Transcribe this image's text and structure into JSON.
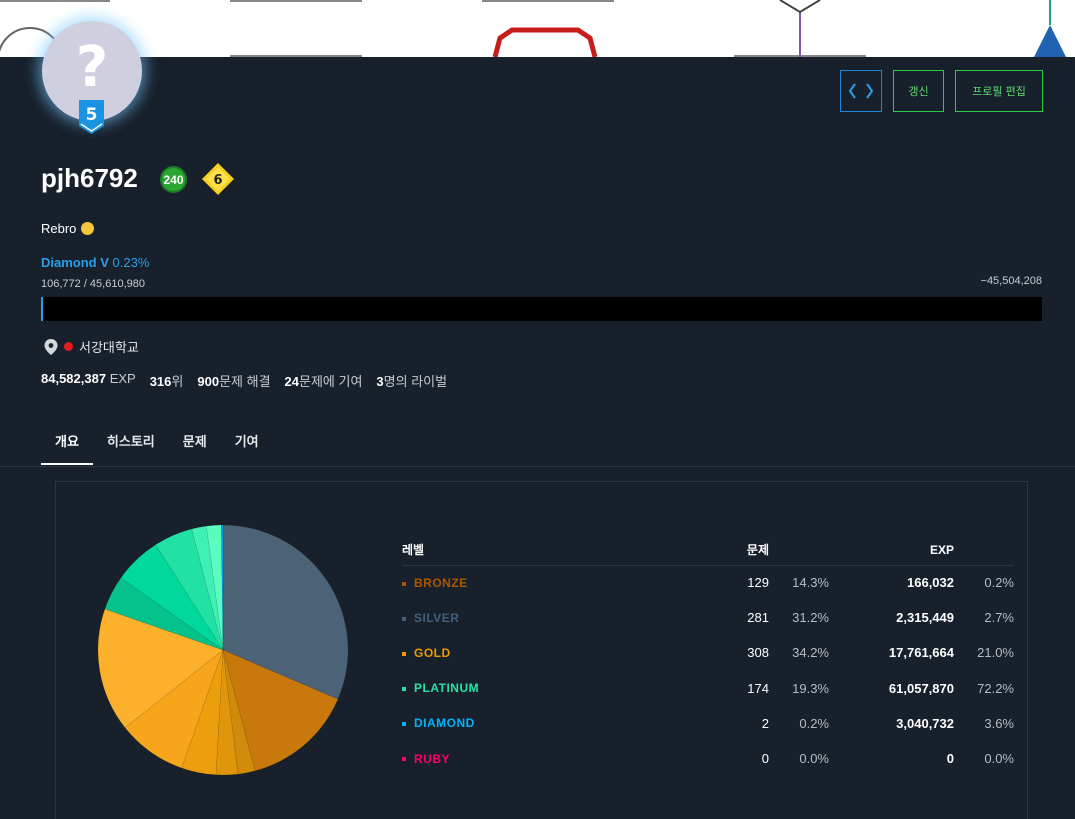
{
  "header": {
    "code_button_label": "/<>",
    "refresh_label": "갱신",
    "edit_label": "프로필 편집"
  },
  "profile": {
    "avatar_glyph": "?",
    "tier_number": "5",
    "username": "pjh6792",
    "level": "240",
    "class_number": "6",
    "bio": "Rebro",
    "rank_name": "Diamond V",
    "rank_pct": "0.23%",
    "progress_text": "106,772 / 45,610,980",
    "remaining_text": "−45,504,208",
    "progress_fraction": 0.0023,
    "school": "서강대학교"
  },
  "stats": [
    {
      "value": "84,582,387",
      "suffix": " EXP"
    },
    {
      "value": "316",
      "suffix": "위"
    },
    {
      "value": "900",
      "suffix": "문제 해결"
    },
    {
      "value": "24",
      "suffix": "문제에 기여"
    },
    {
      "value": "3",
      "suffix": "명의 라이벌"
    }
  ],
  "tabs": [
    {
      "label": "개요",
      "active": true
    },
    {
      "label": "히스토리",
      "active": false
    },
    {
      "label": "문제",
      "active": false
    },
    {
      "label": "기여",
      "active": false
    }
  ],
  "table": {
    "headers": {
      "level": "레벨",
      "problems": "문제",
      "exp": "EXP"
    },
    "rows": [
      {
        "level": "BRONZE",
        "color": "#ad5600",
        "count": "129",
        "count_pct": "14.3%",
        "exp": "166,032",
        "exp_pct": "0.2%"
      },
      {
        "level": "SILVER",
        "color": "#435f7a",
        "count": "281",
        "count_pct": "31.2%",
        "exp": "2,315,449",
        "exp_pct": "2.7%"
      },
      {
        "level": "GOLD",
        "color": "#ec9a00",
        "count": "308",
        "count_pct": "34.2%",
        "exp": "17,761,664",
        "exp_pct": "21.0%"
      },
      {
        "level": "PLATINUM",
        "color": "#27e2a4",
        "count": "174",
        "count_pct": "19.3%",
        "exp": "61,057,870",
        "exp_pct": "72.2%"
      },
      {
        "level": "DIAMOND",
        "color": "#00b4fc",
        "count": "2",
        "count_pct": "0.2%",
        "exp": "3,040,732",
        "exp_pct": "3.6%"
      },
      {
        "level": "RUBY",
        "color": "#ff0062",
        "count": "0",
        "count_pct": "0.0%",
        "exp": "0",
        "exp_pct": "0.0%"
      }
    ]
  },
  "chart_data": {
    "type": "pie",
    "slices": [
      {
        "label": "Silver I-V",
        "value": 281,
        "color": "#4b6277"
      },
      {
        "label": "Bronze",
        "value": 129,
        "color": "#c9780b"
      },
      {
        "label": "Gold V",
        "value": 20,
        "color": "#d18b0a"
      },
      {
        "label": "Gold IV",
        "value": 25,
        "color": "#e0950a"
      },
      {
        "label": "Gold III",
        "value": 40,
        "color": "#ec9e0c"
      },
      {
        "label": "Gold II",
        "value": 80,
        "color": "#f7a51b"
      },
      {
        "label": "Gold I",
        "value": 143,
        "color": "#fbb12b"
      },
      {
        "label": "Platinum V",
        "value": 40,
        "color": "#05c28b"
      },
      {
        "label": "Platinum IV",
        "value": 55,
        "color": "#00d99b"
      },
      {
        "label": "Platinum III",
        "value": 45,
        "color": "#21e1a5"
      },
      {
        "label": "Platinum II",
        "value": 17,
        "color": "#3ff0b4"
      },
      {
        "label": "Platinum I",
        "value": 17,
        "color": "#5bfcc0"
      },
      {
        "label": "Diamond",
        "value": 2,
        "color": "#0fa2e6"
      }
    ]
  }
}
